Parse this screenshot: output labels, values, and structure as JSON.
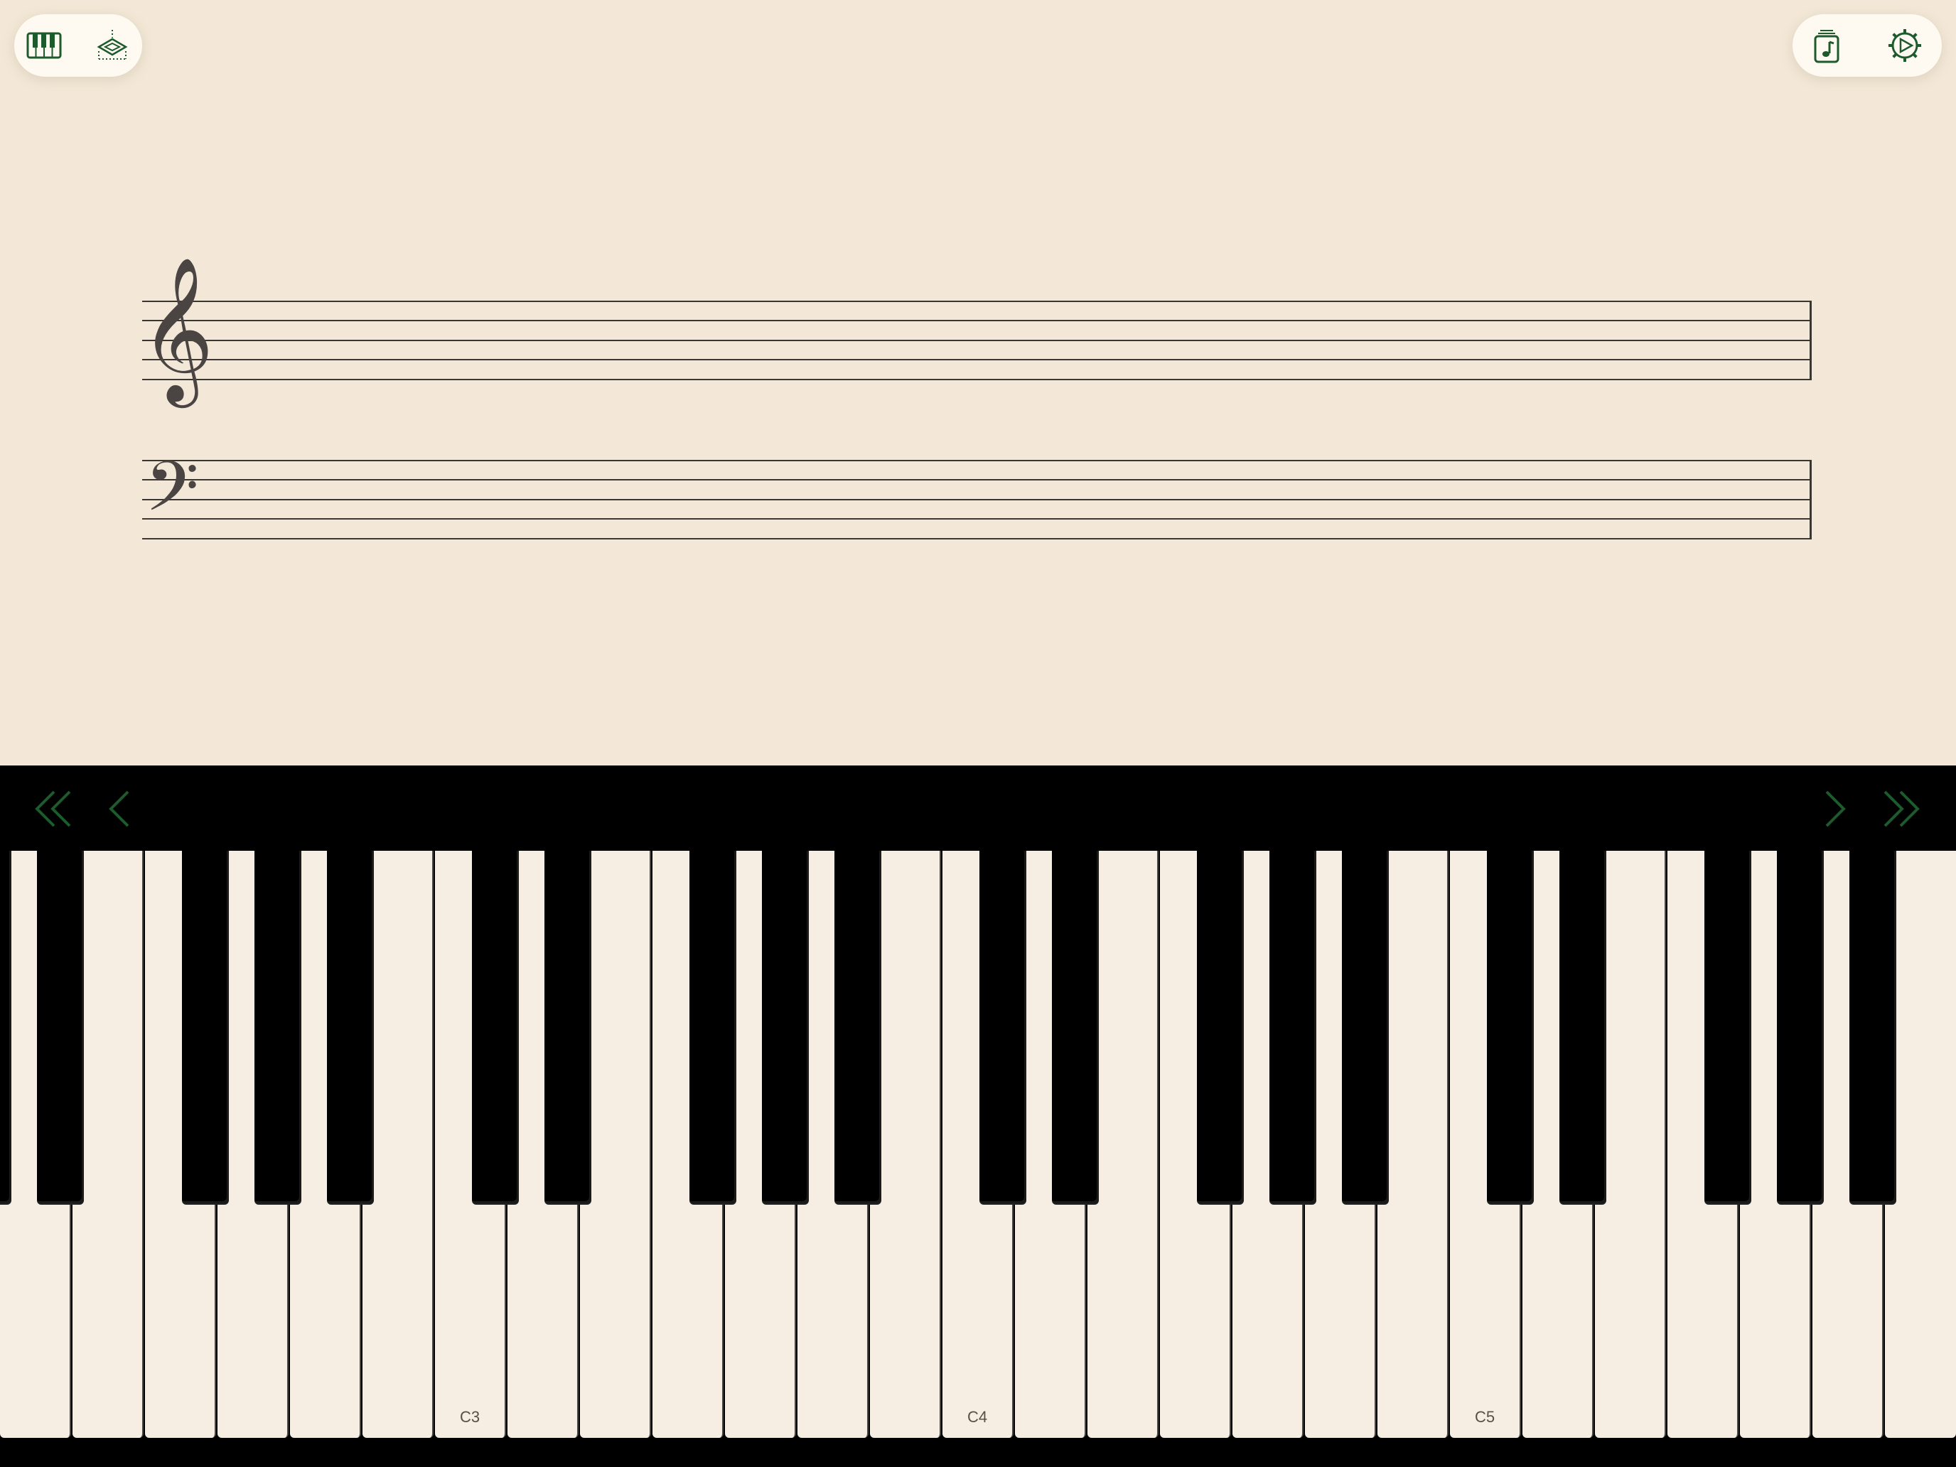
{
  "toolbar_left": {
    "icons": [
      "piano-keyboard-icon",
      "layers-icon"
    ]
  },
  "toolbar_right": {
    "icons": [
      "sheet-music-icon",
      "settings-gear-icon"
    ]
  },
  "staves": [
    {
      "clef": "treble",
      "glyph": "𝄞"
    },
    {
      "clef": "bass",
      "glyph": "𝄢"
    }
  ],
  "navigation": {
    "icons": [
      "double-chevron-left-icon",
      "chevron-left-icon",
      "chevron-right-icon",
      "double-chevron-right-icon"
    ]
  },
  "keyboard": {
    "white_key_labels": [
      "C3",
      "C4",
      "C5"
    ]
  },
  "colors": {
    "background": "#f3e8d7",
    "accent_green": "#1d5a2c",
    "keyboard_bg": "#000000",
    "white_key": "#f6eee2"
  }
}
